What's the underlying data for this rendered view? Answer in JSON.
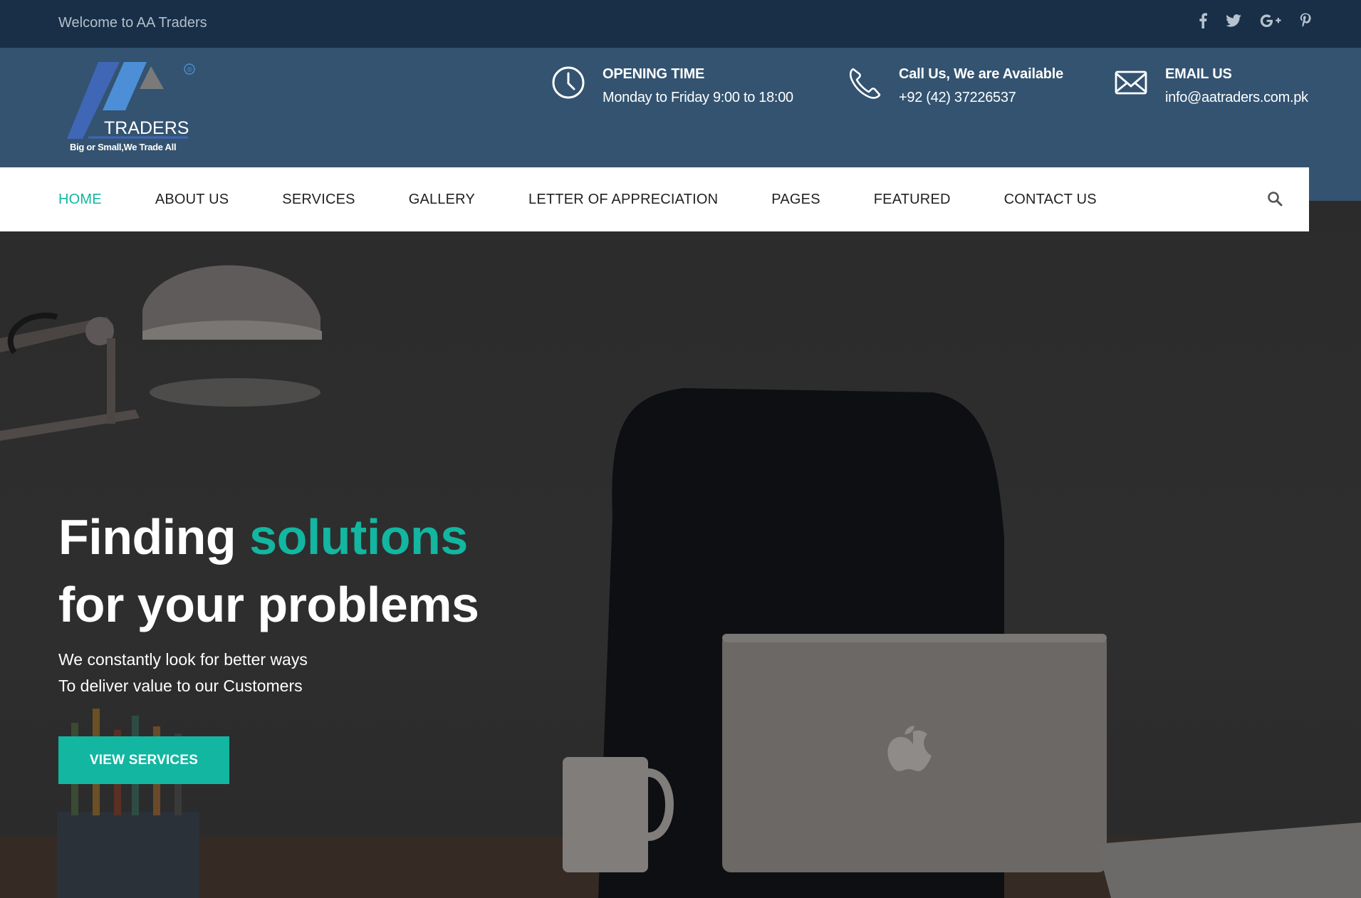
{
  "topbar": {
    "welcome": "Welcome to AA Traders",
    "social": [
      "facebook-icon",
      "twitter-icon",
      "google-plus-icon",
      "pinterest-icon"
    ]
  },
  "logo": {
    "name": "TRADERS",
    "tagline": "Big or Small,We Trade All",
    "mark": "®"
  },
  "header": {
    "opening": {
      "icon": "clock-icon",
      "title": "OPENING TIME",
      "text": "Monday to Friday 9:00 to 18:00"
    },
    "call": {
      "icon": "phone-icon",
      "title": "Call Us, We are Available",
      "text": "+92 (42) 37226537"
    },
    "email": {
      "icon": "envelope-icon",
      "title": "EMAIL US",
      "text": "info@aatraders.com.pk"
    }
  },
  "nav": {
    "items": [
      "HOME",
      "ABOUT US",
      "SERVICES",
      "GALLERY",
      "LETTER OF APPRECIATION",
      "PAGES",
      "FEATURED",
      "CONTACT US"
    ],
    "active": "HOME",
    "search_icon": "search-icon"
  },
  "hero": {
    "title_part1": "Finding ",
    "title_accent": "solutions",
    "title_line2": "for your problems",
    "sub_line1": "We constantly look for better ways",
    "sub_line2": "To deliver value to our Customers",
    "cta": "VIEW SERVICES"
  },
  "colors": {
    "topbar_bg": "#182f47",
    "header_bg": "#335370",
    "accent": "#13b6a0",
    "nav_bg": "#ffffff",
    "nav_text": "#222222"
  }
}
